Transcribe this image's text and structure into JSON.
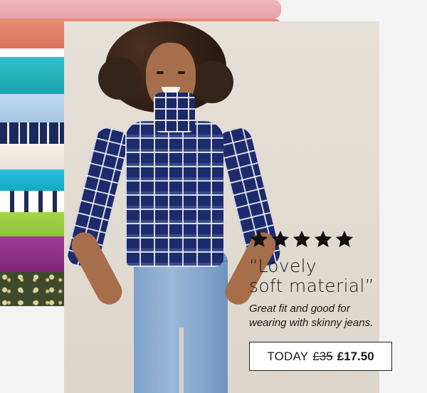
{
  "review": {
    "rating": 5,
    "star_icon": "star-icon",
    "quote_line1": "“Lovely",
    "quote_line2": "soft material”",
    "detail_line1": "Great fit and good for",
    "detail_line2": "wearing with skinny jeans."
  },
  "price": {
    "label": "TODAY",
    "was": "£35",
    "now": "£17.50"
  },
  "colors": {
    "panel": "#e6e0d8",
    "shirt_navy": "#1d2b6c",
    "text": "#1a1a1a"
  }
}
